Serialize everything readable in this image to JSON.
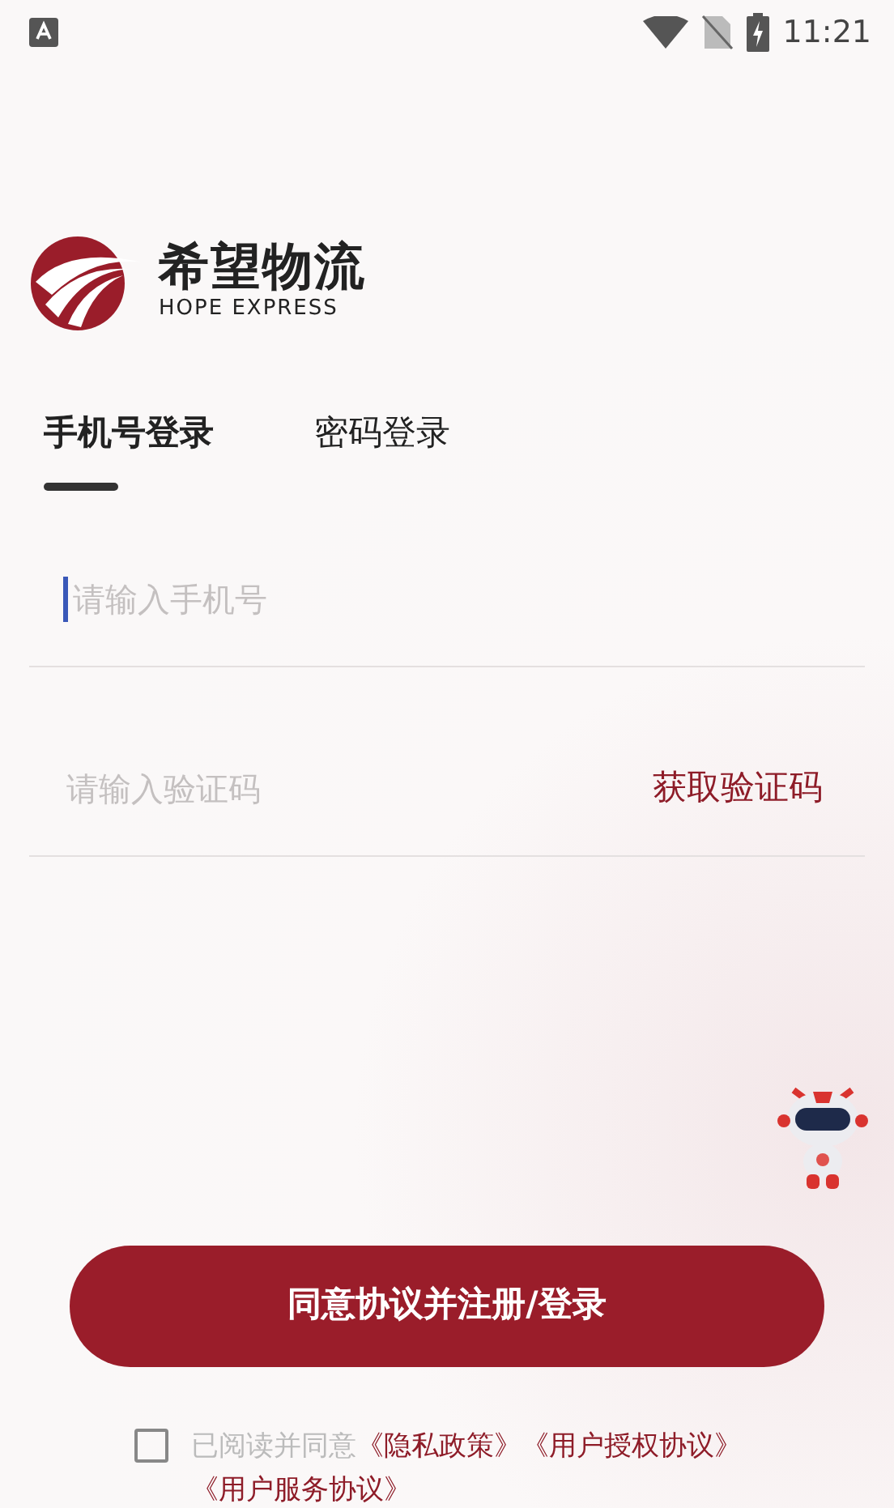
{
  "status_bar": {
    "time": "11:21"
  },
  "logo": {
    "name": "希望物流",
    "subtitle": "HOPE EXPRESS"
  },
  "tabs": [
    {
      "label": "手机号登录",
      "selected": true
    },
    {
      "label": "密码登录",
      "selected": false
    }
  ],
  "fields": [
    {
      "placeholder": "请输入手机号",
      "focused": true
    },
    {
      "placeholder": "请输入验证码",
      "focused": false,
      "action": "获取验证码"
    }
  ],
  "submit": "同意协议并注册/登录",
  "agreement": {
    "checked": false,
    "text": "已阅读并同意",
    "links": [
      "《隐私政策》",
      "《用户授权协议》",
      "《用户服务协议》"
    ]
  }
}
